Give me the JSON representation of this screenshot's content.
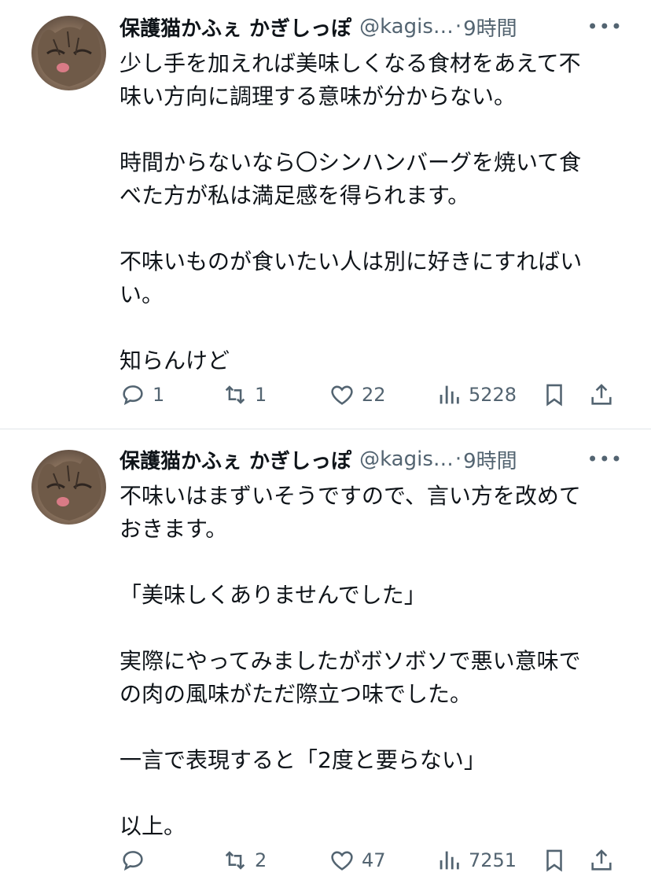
{
  "tweets": [
    {
      "name": "保護猫かふぇ かぎしっぽ",
      "handle": "@kagis…",
      "separator": "·",
      "time": "9時間",
      "more": "•••",
      "text": "少し手を加えれば美味しくなる食材をあえて不\n味い方向に調理する意味が分からない。\n\n時間からないなら〇シンハンバーグを焼いて食\nべた方が私は満足感を得られます。\n\n不味いものが食いたい人は別に好きにすればい\nい。\n\n知らんけど",
      "replies": "1",
      "retweets": "1",
      "likes": "22",
      "views": "5228"
    },
    {
      "name": "保護猫かふぇ かぎしっぽ",
      "handle": "@kagis…",
      "separator": "·",
      "time": "9時間",
      "more": "•••",
      "text": "不味いはまずいそうですので、言い方を改めて\nおきます。\n\n「美味しくありませんでした」\n\n実際にやってみましたがボソボソで悪い意味で\nの肉の風味がただ際立つ味でした。\n\n一言で表現すると「2度と要らない」\n\n以上。",
      "replies": "",
      "retweets": "2",
      "likes": "47",
      "views": "7251"
    }
  ],
  "icons": [
    "reply-icon",
    "retweet-icon",
    "like-icon",
    "views-icon",
    "bookmark-icon",
    "share-icon",
    "more-icon"
  ],
  "colors": {
    "text": "#0f1419",
    "muted": "#536471",
    "divider": "#e1e5e8"
  }
}
